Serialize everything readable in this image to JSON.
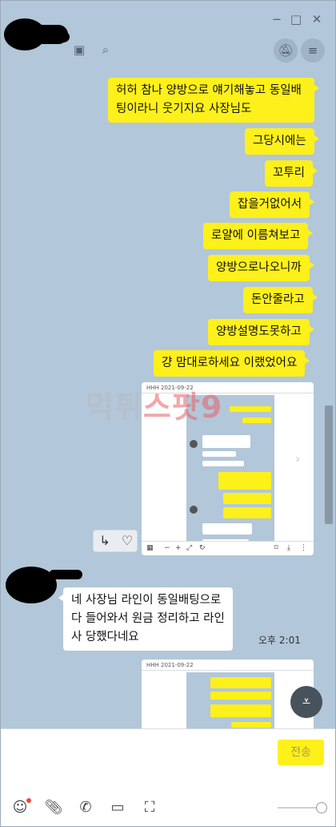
{
  "header": {
    "minimize_icon": "minimize-icon",
    "maximize_icon": "maximize-icon",
    "close_icon": "close-icon"
  },
  "messages": {
    "m1": "허허 참나 양방으로 얘기해놓고 동일배팅이라니 웃기지요 사장님도",
    "m2": "그당시에는",
    "m3": "꼬투리",
    "m4": "잡을거없어서",
    "m5": "로얄에 이름쳐보고",
    "m6": "양방으로나오니까",
    "m7": "돈안줄라고",
    "m8": "양방설명도못하고",
    "m9": "걍 맘대로하세요 이랬었어요",
    "reply": "네 사장님 라인이 동일배팅으로 다 들어와서 원금 정리하고 라인사 당했다네요",
    "reply_time": "오후 2:01"
  },
  "image1": {
    "title": "HHH  2021-09-22"
  },
  "image2": {
    "title": "HHH  2021-09-22"
  },
  "watermark": {
    "part1": "먹튀",
    "part2": "스팟9"
  },
  "input": {
    "placeholder": "",
    "send_label": "전송"
  },
  "colors": {
    "chat_bg": "#b2c7d9",
    "my_bubble": "#fef01b",
    "other_bubble": "#ffffff"
  }
}
